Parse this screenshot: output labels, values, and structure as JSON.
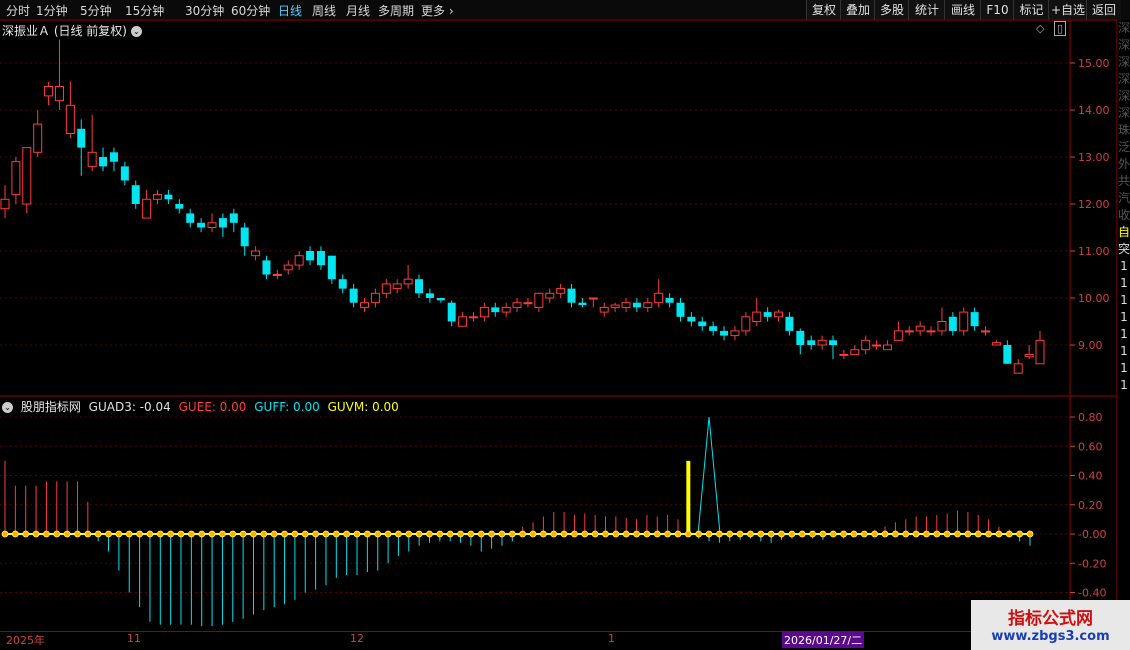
{
  "toolbar": {
    "periods": [
      "分时",
      "1分钟",
      "5分钟",
      "15分钟",
      "30分钟",
      "60分钟",
      "日线",
      "周线",
      "月线",
      "多周期",
      "更多"
    ],
    "active": "日线",
    "more_arrow": "›",
    "right_buttons": [
      "复权",
      "叠加",
      "多股",
      "统计",
      "画线",
      "F10",
      "标记",
      "+自选",
      "返回"
    ]
  },
  "chart": {
    "title": "深振业Ａ (日线 前复权)",
    "y_ticks": [
      "15.00",
      "14.00",
      "13.00",
      "12.00",
      "11.00",
      "10.00",
      "9.00"
    ]
  },
  "indicator": {
    "name": "股朋指标网",
    "guad3": "GUAD3: -0.04",
    "guee": "GUEE: 0.00",
    "guff": "GUFF: 0.00",
    "guvm": "GUVM: 0.00",
    "y_ticks": [
      "0.80",
      "0.60",
      "0.40",
      "0.20",
      "-0.00",
      "-0.20",
      "-0.40"
    ]
  },
  "date_axis": {
    "labels": [
      "2025年",
      "11",
      "12",
      "1"
    ],
    "selected": "2026/01/27/二"
  },
  "right_strip": [
    "深",
    "深",
    "深",
    "深",
    "深",
    "深",
    "珠",
    "泛",
    "外",
    "共",
    "汽",
    "收",
    "自",
    "突",
    "1",
    "1",
    "1",
    "1",
    "1",
    "1",
    "1",
    "1"
  ],
  "watermark": {
    "line1": "指标公式网",
    "line2": "www.zbgs3.com"
  },
  "colors": {
    "up": "#ff3b3b",
    "down": "#00e5f0",
    "grid": "#5a0000",
    "axis": "#d04040",
    "yellow": "#ffff00"
  },
  "chart_data": {
    "type": "candlestick",
    "candles": [
      [
        11.9,
        12.1,
        11.7,
        12.4
      ],
      [
        12.2,
        12.9,
        12.0,
        13.0
      ],
      [
        12.0,
        13.2,
        11.8,
        13.2
      ],
      [
        13.1,
        13.7,
        13.0,
        14.0
      ],
      [
        14.3,
        14.5,
        14.1,
        14.6
      ],
      [
        14.2,
        14.5,
        14.0,
        15.5
      ],
      [
        13.5,
        14.1,
        13.4,
        14.6
      ],
      [
        13.6,
        13.2,
        12.6,
        13.8
      ],
      [
        12.8,
        13.1,
        12.7,
        13.9
      ],
      [
        13.0,
        12.8,
        12.7,
        13.2
      ],
      [
        13.1,
        12.9,
        12.7,
        13.2
      ],
      [
        12.8,
        12.5,
        12.4,
        12.9
      ],
      [
        12.4,
        12.0,
        11.9,
        12.5
      ],
      [
        11.7,
        12.1,
        11.7,
        12.3
      ],
      [
        12.1,
        12.2,
        12.0,
        12.3
      ],
      [
        12.2,
        12.1,
        12.0,
        12.3
      ],
      [
        12.0,
        11.9,
        11.8,
        12.1
      ],
      [
        11.8,
        11.6,
        11.5,
        11.9
      ],
      [
        11.6,
        11.5,
        11.4,
        11.7
      ],
      [
        11.5,
        11.6,
        11.4,
        11.8
      ],
      [
        11.7,
        11.5,
        11.3,
        11.8
      ],
      [
        11.8,
        11.6,
        11.4,
        11.9
      ],
      [
        11.5,
        11.1,
        10.9,
        11.6
      ],
      [
        10.9,
        11.0,
        10.8,
        11.1
      ],
      [
        10.8,
        10.5,
        10.4,
        10.9
      ],
      [
        10.5,
        10.5,
        10.4,
        10.6
      ],
      [
        10.6,
        10.7,
        10.5,
        10.8
      ],
      [
        10.7,
        10.9,
        10.6,
        11.0
      ],
      [
        11.0,
        10.8,
        10.7,
        11.1
      ],
      [
        11.0,
        10.7,
        10.6,
        11.1
      ],
      [
        10.9,
        10.4,
        10.3,
        10.9
      ],
      [
        10.4,
        10.2,
        10.1,
        10.5
      ],
      [
        10.2,
        9.9,
        9.8,
        10.3
      ],
      [
        9.8,
        9.9,
        9.7,
        10.0
      ],
      [
        9.9,
        10.1,
        9.8,
        10.2
      ],
      [
        10.1,
        10.3,
        10.0,
        10.4
      ],
      [
        10.2,
        10.3,
        10.1,
        10.4
      ],
      [
        10.3,
        10.4,
        10.2,
        10.7
      ],
      [
        10.4,
        10.1,
        10.0,
        10.5
      ],
      [
        10.1,
        10.0,
        9.9,
        10.2
      ],
      [
        10.0,
        9.95,
        9.9,
        10.0
      ],
      [
        9.9,
        9.5,
        9.4,
        9.95
      ],
      [
        9.4,
        9.6,
        9.4,
        9.7
      ],
      [
        9.6,
        9.6,
        9.5,
        9.7
      ],
      [
        9.6,
        9.8,
        9.5,
        9.9
      ],
      [
        9.8,
        9.7,
        9.6,
        9.9
      ],
      [
        9.7,
        9.8,
        9.6,
        9.9
      ],
      [
        9.8,
        9.9,
        9.7,
        10.0
      ],
      [
        9.9,
        9.9,
        9.8,
        10.0
      ],
      [
        9.8,
        10.1,
        9.7,
        10.1
      ],
      [
        10.0,
        10.1,
        9.9,
        10.2
      ],
      [
        10.1,
        10.2,
        10.0,
        10.3
      ],
      [
        10.2,
        9.9,
        9.8,
        10.3
      ],
      [
        9.9,
        9.85,
        9.8,
        10.0
      ],
      [
        10.0,
        10.0,
        9.8,
        10.0
      ],
      [
        9.7,
        9.8,
        9.6,
        9.9
      ],
      [
        9.8,
        9.85,
        9.7,
        9.9
      ],
      [
        9.8,
        9.9,
        9.7,
        10.0
      ],
      [
        9.9,
        9.8,
        9.7,
        10.0
      ],
      [
        9.8,
        9.9,
        9.7,
        10.0
      ],
      [
        9.9,
        10.1,
        9.8,
        10.4
      ],
      [
        10.0,
        9.9,
        9.8,
        10.1
      ],
      [
        9.9,
        9.6,
        9.5,
        10.0
      ],
      [
        9.6,
        9.5,
        9.4,
        9.7
      ],
      [
        9.5,
        9.4,
        9.3,
        9.6
      ],
      [
        9.4,
        9.3,
        9.2,
        9.5
      ],
      [
        9.3,
        9.2,
        9.1,
        9.4
      ],
      [
        9.2,
        9.3,
        9.1,
        9.4
      ],
      [
        9.3,
        9.6,
        9.2,
        9.7
      ],
      [
        9.5,
        9.7,
        9.4,
        10.0
      ],
      [
        9.7,
        9.6,
        9.5,
        9.8
      ],
      [
        9.6,
        9.7,
        9.5,
        9.75
      ],
      [
        9.6,
        9.3,
        9.2,
        9.7
      ],
      [
        9.3,
        9.0,
        8.8,
        9.35
      ],
      [
        9.1,
        9.0,
        8.9,
        9.2
      ],
      [
        9.0,
        9.1,
        8.9,
        9.2
      ],
      [
        9.1,
        9.0,
        8.7,
        9.2
      ],
      [
        8.8,
        8.8,
        8.7,
        8.9
      ],
      [
        8.8,
        8.9,
        8.8,
        9.0
      ],
      [
        8.9,
        9.1,
        8.8,
        9.2
      ],
      [
        9.0,
        9.0,
        8.9,
        9.1
      ],
      [
        8.9,
        9.0,
        8.9,
        9.1
      ],
      [
        9.1,
        9.3,
        9.1,
        9.5
      ],
      [
        9.3,
        9.3,
        9.2,
        9.4
      ],
      [
        9.3,
        9.4,
        9.2,
        9.5
      ],
      [
        9.3,
        9.3,
        9.2,
        9.4
      ],
      [
        9.3,
        9.5,
        9.2,
        9.8
      ],
      [
        9.6,
        9.3,
        9.2,
        9.7
      ],
      [
        9.3,
        9.7,
        9.2,
        9.8
      ],
      [
        9.7,
        9.4,
        9.3,
        9.8
      ],
      [
        9.3,
        9.3,
        9.2,
        9.4
      ],
      [
        9.0,
        9.05,
        9.0,
        9.1
      ],
      [
        9.0,
        8.6,
        8.6,
        9.1
      ],
      [
        8.4,
        8.6,
        8.4,
        8.7
      ],
      [
        8.75,
        8.8,
        8.7,
        9.0
      ],
      [
        8.6,
        9.1,
        8.6,
        9.3
      ]
    ],
    "indicator_bars": [
      0.5,
      0.33,
      0.33,
      0.33,
      0.36,
      0.36,
      0.36,
      0.36,
      0.22,
      0,
      0,
      0,
      0,
      0,
      0,
      0,
      0,
      0,
      0,
      0,
      0,
      0,
      0,
      0,
      0,
      0,
      0,
      0,
      0,
      0,
      0,
      0,
      0,
      0,
      0,
      0,
      0,
      0,
      0,
      0,
      0,
      0,
      0,
      0,
      0,
      0,
      0,
      0,
      0,
      0,
      0.05,
      0.08,
      0.12,
      0.15,
      0.15,
      0.13,
      0.14,
      0.13,
      0.12,
      0.12,
      0.11,
      0.1,
      0.13,
      0.12,
      0.13,
      0.1,
      0.08,
      0,
      0,
      0,
      0,
      0,
      0,
      0,
      0,
      0,
      0,
      0,
      0,
      0,
      0,
      0,
      0,
      0,
      0.03,
      0.05,
      0.08,
      0.1,
      0.12,
      0.12,
      0.13,
      0.14,
      0.16,
      0.15,
      0.13,
      0.1,
      0.05,
      0.03,
      0,
      0
    ],
    "indicator_neg": [
      0,
      0,
      0,
      0,
      0,
      0,
      0,
      0,
      0,
      -0.05,
      -0.12,
      -0.25,
      -0.4,
      -0.5,
      -0.6,
      -0.62,
      -0.62,
      -0.62,
      -0.62,
      -0.63,
      -0.63,
      -0.62,
      -0.6,
      -0.58,
      -0.55,
      -0.52,
      -0.5,
      -0.48,
      -0.45,
      -0.4,
      -0.38,
      -0.35,
      -0.3,
      -0.28,
      -0.28,
      -0.26,
      -0.25,
      -0.2,
      -0.15,
      -0.12,
      -0.08,
      -0.06,
      -0.05,
      -0.05,
      -0.06,
      -0.08,
      -0.12,
      -0.1,
      -0.08,
      -0.05,
      0,
      0,
      0,
      0,
      0,
      0,
      0,
      0,
      0,
      0,
      0,
      0,
      0,
      0,
      0,
      0,
      0,
      -0.03,
      -0.05,
      -0.06,
      -0.05,
      -0.04,
      -0.03,
      -0.05,
      -0.06,
      -0.04,
      -0.03,
      -0.02,
      -0.03,
      -0.04,
      -0.02,
      -0.03,
      -0.02,
      -0.02,
      0,
      0,
      0,
      0,
      0,
      0,
      0,
      0,
      0,
      0,
      0,
      0,
      0,
      0,
      -0.05,
      -0.08
    ],
    "yellow_spike_index": 66,
    "yellow_spike_value": 0.5,
    "blue_spike_index": 68,
    "blue_spike_value": 0.8,
    "price_range": [
      8.0,
      15.5
    ],
    "indicator_range": [
      -0.62,
      0.8
    ]
  }
}
